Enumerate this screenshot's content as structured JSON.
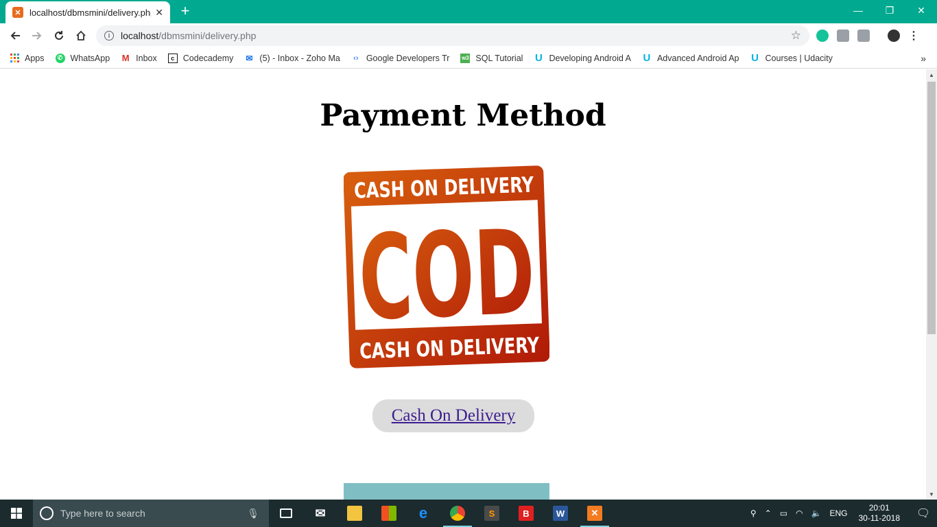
{
  "browser": {
    "tab_title": "localhost/dbmsmini/delivery.php",
    "tab_close": "✕",
    "new_tab": "+",
    "url_host": "localhost",
    "url_path": "/dbmsmini/delivery.php",
    "window_controls": {
      "minimize": "—",
      "restore": "❐",
      "close": "✕"
    }
  },
  "bookmarks": [
    {
      "label": "Apps",
      "icon": "apps-grid-icon"
    },
    {
      "label": "WhatsApp",
      "icon": "whatsapp-icon"
    },
    {
      "label": "Inbox",
      "icon": "gmail-icon"
    },
    {
      "label": "Codecademy",
      "icon": "codecademy-icon"
    },
    {
      "label": "(5) - Inbox - Zoho Ma",
      "icon": "zoho-mail-icon"
    },
    {
      "label": "Google Developers Tr",
      "icon": "google-developers-icon"
    },
    {
      "label": "SQL Tutorial",
      "icon": "w3schools-icon"
    },
    {
      "label": "Developing Android A",
      "icon": "udacity-icon"
    },
    {
      "label": "Advanced Android Ap",
      "icon": "udacity-icon"
    },
    {
      "label": "Courses | Udacity",
      "icon": "udacity-icon"
    }
  ],
  "page": {
    "title": "Payment Method",
    "stamp": {
      "top_text": "CASH ON DELIVERY",
      "center_text": "COD",
      "bottom_text": "CASH ON DELIVERY"
    },
    "cod_link": "Cash On Delivery"
  },
  "taskbar": {
    "search_placeholder": "Type here to search",
    "apps": [
      "task-view",
      "mail",
      "file-explorer",
      "store",
      "edge",
      "chrome",
      "sublime-text",
      "brave",
      "word",
      "xampp"
    ],
    "language": "ENG",
    "time": "20:01",
    "date": "30-11-2018"
  },
  "colors": {
    "chrome_frame": "#00a98f",
    "stamp_orange": "#d8600e",
    "stamp_red": "#b01a08",
    "button_bg": "#dcdcdc",
    "link": "#3d1d8f"
  }
}
